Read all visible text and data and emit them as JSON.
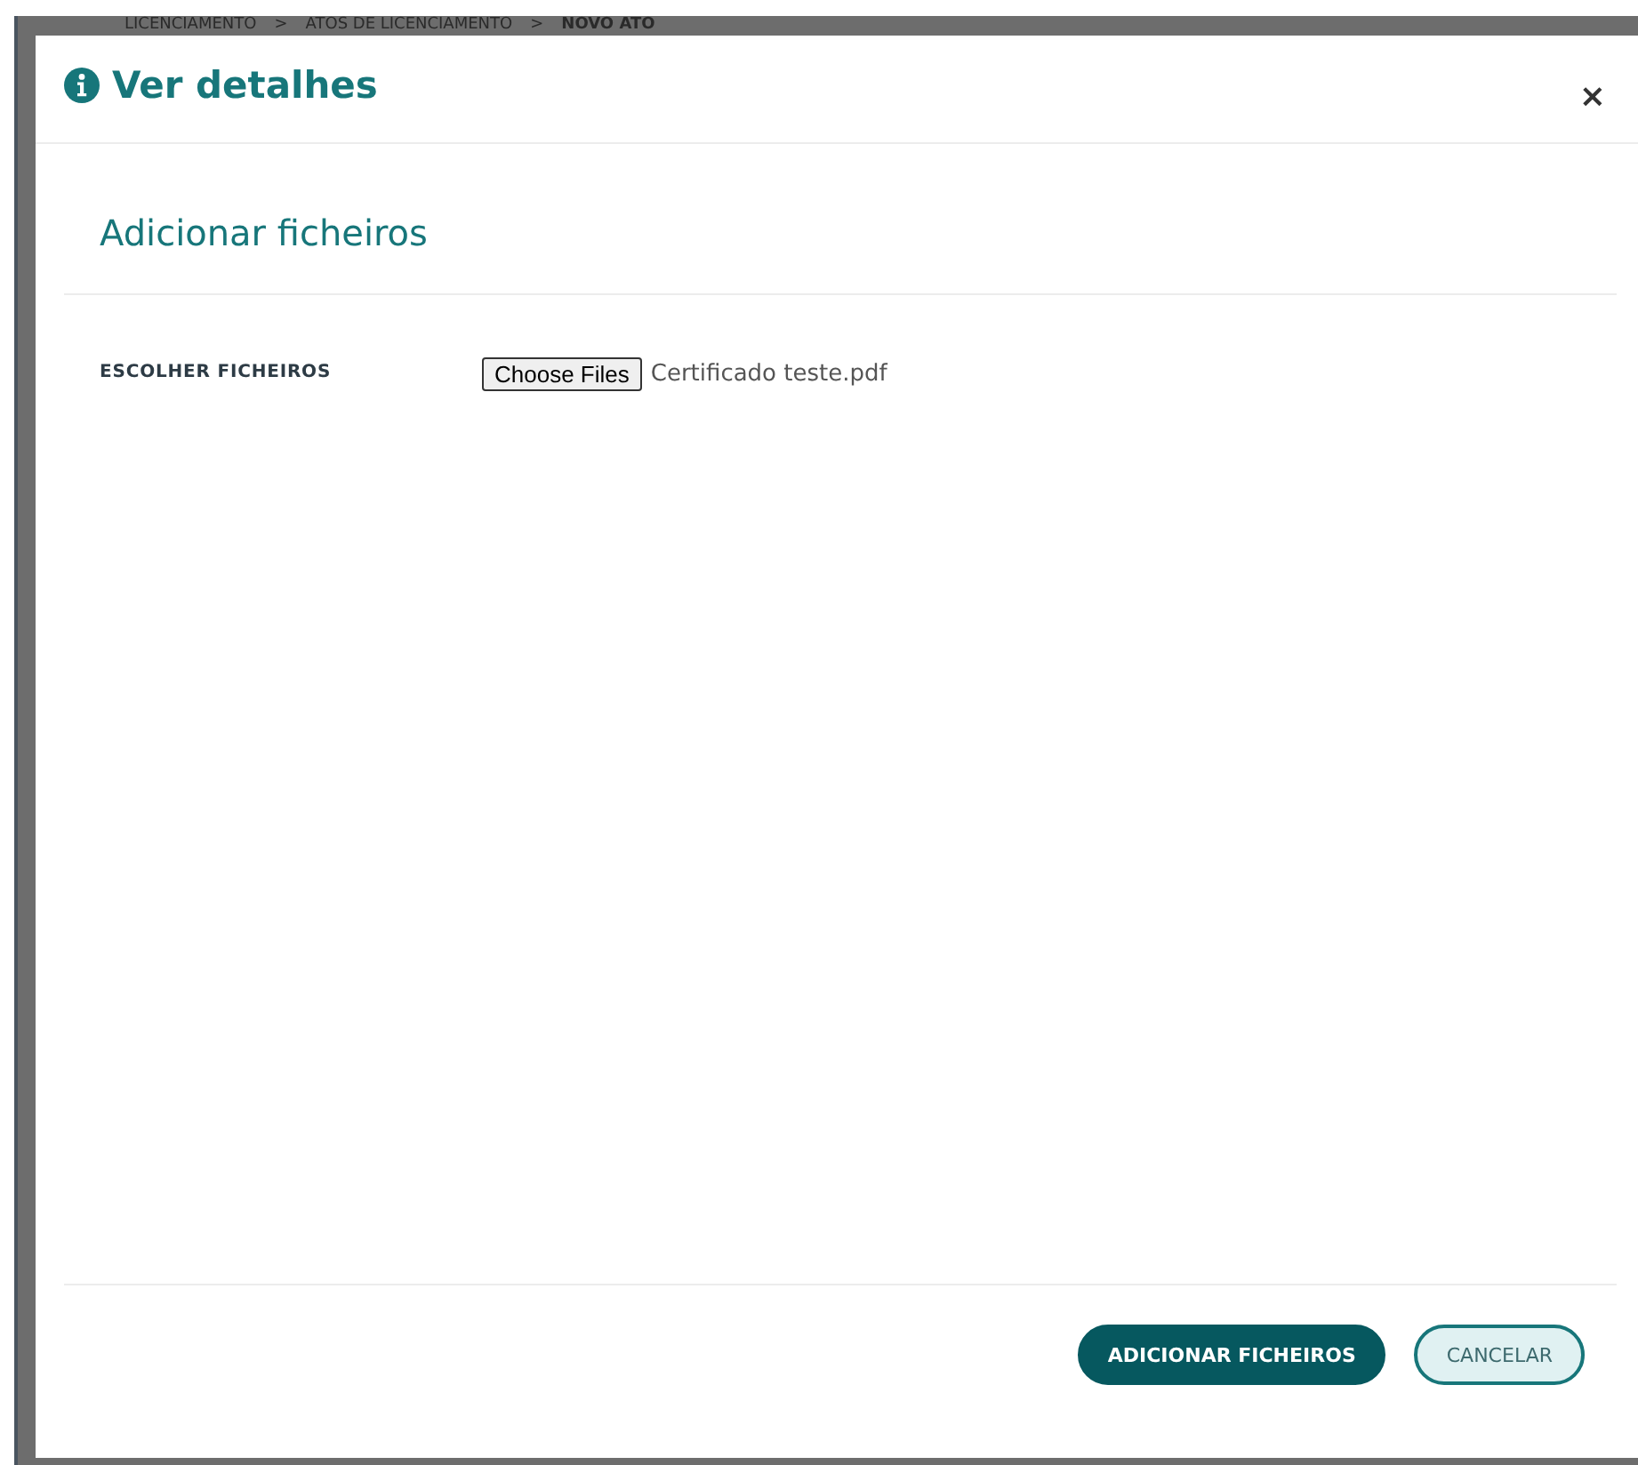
{
  "background": {
    "breadcrumb": [
      "LICENCIAMENTO",
      ">",
      "ATOS DE LICENCIAMENTO",
      ">",
      "NOVO ATO"
    ]
  },
  "dialog": {
    "title": "Ver detalhes",
    "close": "×",
    "section_title": "Adicionar ficheiros",
    "fields": [
      {
        "kind": "file",
        "label": "ESCOLHER FICHEIROS",
        "button": "Choose Files",
        "value": "Certificado teste.pdf"
      }
    ],
    "buttons": [
      {
        "kind": "primary",
        "label": "ADICIONAR FICHEIROS"
      },
      {
        "kind": "secondary",
        "label": "CANCELAR"
      }
    ]
  }
}
